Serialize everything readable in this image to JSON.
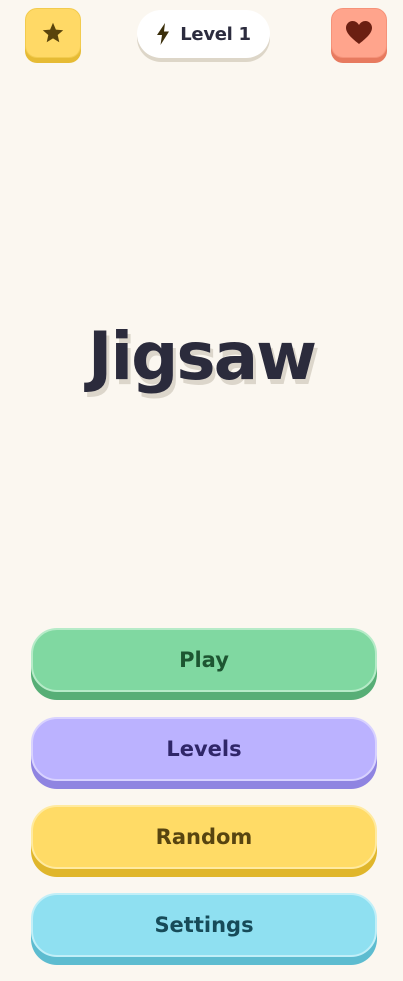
{
  "header": {
    "star_icon": "star-icon",
    "heart_icon": "heart-icon",
    "level_icon": "lightning-bolt-icon",
    "level_label": "Level 1"
  },
  "title": "Jigsaw",
  "menu": {
    "play": "Play",
    "levels": "Levels",
    "random": "Random",
    "settings": "Settings"
  },
  "colors": {
    "background": "#fbf7f0",
    "play": "#80d8a1",
    "levels": "#bbb2ff",
    "random": "#ffdb66",
    "settings": "#8fe0f1",
    "star_button": "#ffd966",
    "heart_button": "#ffa48c"
  }
}
